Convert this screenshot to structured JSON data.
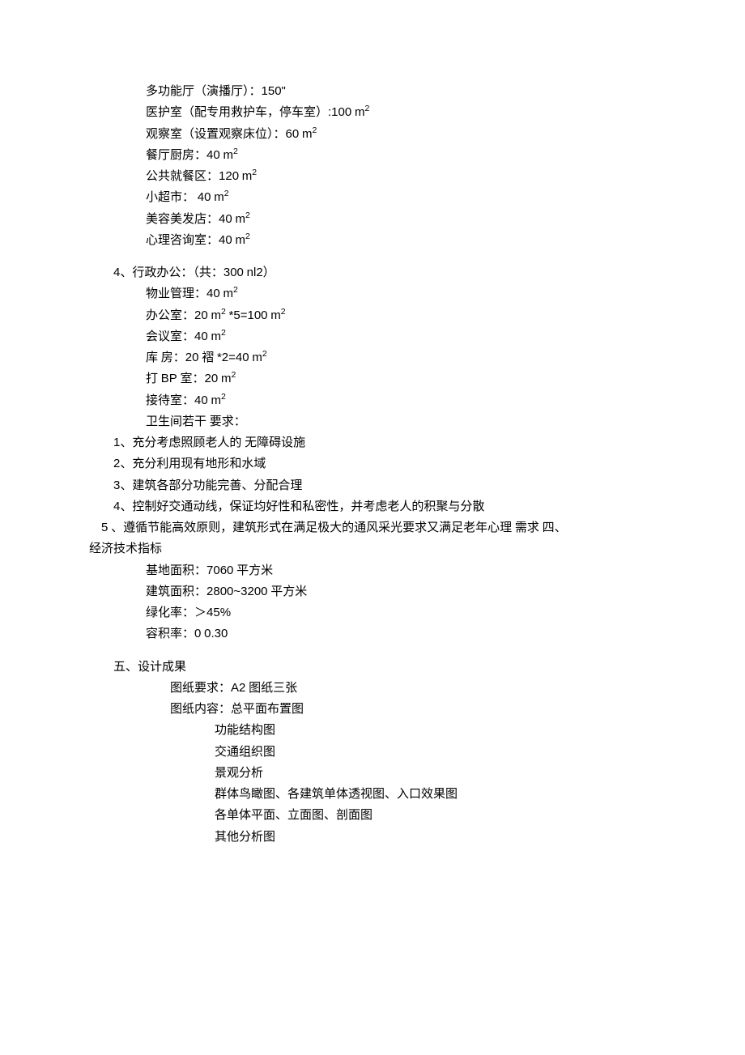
{
  "section_a": [
    "多功能厅（演播厅）：150\"",
    "医护室（配专用救护车，停车室）:100 m²",
    "观察室（设置观察床位）：60 m²",
    "餐厅厨房：40 m²",
    "公共就餐区：120 m²",
    "小超市： 40 m²",
    "美容美发店：40 m²",
    "心理咨询室：40 m²"
  ],
  "section_b_header": "4、行政办公：（共：300 nl2）",
  "section_b_items": [
    "物业管理：40 m²",
    "办公室：20 m² *5=100 m²",
    "会议室：40 m²",
    "库 房：20 褶 *2=40 m²",
    "打 BP 室：20 m²",
    "接待室：40 m²",
    "卫生间若干 要求："
  ],
  "requirements": [
    "1、充分考虑照顾老人的 无障碍设施",
    "2、充分利用现有地形和水域",
    "3、建筑各部分功能完善、分配合理",
    "4、控制好交通动线，保证均好性和私密性，并考虑老人的积聚与分散"
  ],
  "req5_line1": "    5 、遵循节能高效原则，建筑形式在满足极大的通风采光要求又满足老年心理 需求 四、",
  "req5_line2": "经济技术指标",
  "metrics": [
    "基地面积：7060 平方米",
    "建筑面积：2800~3200 平方米",
    "绿化率：＞45%",
    "容积率：0 0.30"
  ],
  "section_5_header": "五、设计成果",
  "drawings_req": "图纸要求：A2 图纸三张",
  "drawings_content_label": "图纸内容：总平面布置图",
  "drawings_list": [
    "功能结构图",
    "交通组织图",
    "景观分析",
    "群体鸟瞰图、各建筑单体透视图、入口效果图",
    "各单体平面、立面图、剖面图",
    "其他分析图"
  ]
}
